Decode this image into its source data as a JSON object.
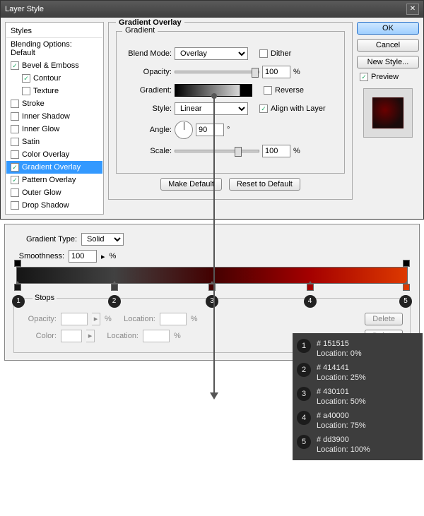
{
  "title": "Layer Style",
  "sidebar": {
    "header": "Styles",
    "blending": "Blending Options: Default",
    "items": [
      {
        "label": "Bevel & Emboss",
        "checked": true
      },
      {
        "label": "Contour",
        "checked": true,
        "sub": true
      },
      {
        "label": "Texture",
        "checked": false,
        "sub": true
      },
      {
        "label": "Stroke",
        "checked": false
      },
      {
        "label": "Inner Shadow",
        "checked": false
      },
      {
        "label": "Inner Glow",
        "checked": false
      },
      {
        "label": "Satin",
        "checked": false
      },
      {
        "label": "Color Overlay",
        "checked": false
      },
      {
        "label": "Gradient Overlay",
        "checked": true,
        "selected": true
      },
      {
        "label": "Pattern Overlay",
        "checked": true
      },
      {
        "label": "Outer Glow",
        "checked": false
      },
      {
        "label": "Drop Shadow",
        "checked": false
      }
    ]
  },
  "panel": {
    "title": "Gradient Overlay",
    "group": "Gradient",
    "blend_label": "Blend Mode:",
    "blend_value": "Overlay",
    "dither": "Dither",
    "opacity_label": "Opacity:",
    "opacity": "100",
    "pct": "%",
    "gradient_label": "Gradient:",
    "reverse": "Reverse",
    "style_label": "Style:",
    "style_value": "Linear",
    "align": "Align with Layer",
    "angle_label": "Angle:",
    "angle": "90",
    "scale_label": "Scale:",
    "scale": "100",
    "make_default": "Make Default",
    "reset": "Reset to Default"
  },
  "buttons": {
    "ok": "OK",
    "cancel": "Cancel",
    "newstyle": "New Style...",
    "preview": "Preview"
  },
  "editor": {
    "type_label": "Gradient Type:",
    "type_value": "Solid",
    "smooth_label": "Smoothness:",
    "smooth": "100",
    "pct": "%",
    "stops": "Stops",
    "opacity": "Opacity:",
    "location": "Location:",
    "color": "Color:",
    "delete": "Delete"
  },
  "chart_data": {
    "type": "table",
    "stops": [
      {
        "n": "1",
        "hex": "# 151515",
        "loc": "Location: 0%"
      },
      {
        "n": "2",
        "hex": "# 414141",
        "loc": "Location: 25%"
      },
      {
        "n": "3",
        "hex": "# 430101",
        "loc": "Location: 50%"
      },
      {
        "n": "4",
        "hex": "# a40000",
        "loc": "Location: 75%"
      },
      {
        "n": "5",
        "hex": "# dd3900",
        "loc": "Location: 100%"
      }
    ]
  }
}
